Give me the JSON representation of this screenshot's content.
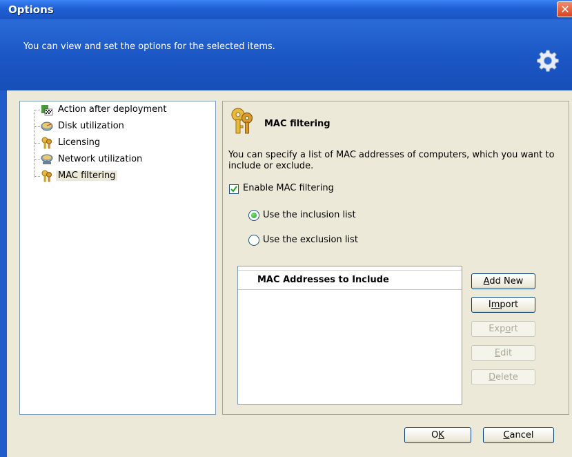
{
  "window": {
    "title": "Options",
    "close_label": "✕"
  },
  "header": {
    "text": "You can view and set the options for the selected items.",
    "icon": "gear-icon"
  },
  "tree": {
    "items": [
      {
        "label": "Action after deployment",
        "icon": "deployment-flag-icon",
        "selected": false
      },
      {
        "label": "Disk utilization",
        "icon": "disk-icon",
        "selected": false
      },
      {
        "label": "Licensing",
        "icon": "keys-icon",
        "selected": false
      },
      {
        "label": "Network utilization",
        "icon": "network-icon",
        "selected": false
      },
      {
        "label": "MAC filtering",
        "icon": "keys-icon",
        "selected": true
      }
    ]
  },
  "panel": {
    "title": "MAC filtering",
    "icon": "keys-icon",
    "description": "You can specify a list of MAC addresses of computers, which you want to include or exclude.",
    "enable_checkbox": {
      "label": "Enable MAC filtering",
      "checked": true
    },
    "radio_inclusion": {
      "label": "Use the inclusion list",
      "selected": true
    },
    "radio_exclusion": {
      "label": "Use the exclusion list",
      "selected": false
    },
    "list": {
      "header": "MAC Addresses to Include",
      "rows": []
    },
    "buttons": {
      "add_new": {
        "prefix": "",
        "key": "A",
        "rest": "dd New",
        "enabled": true
      },
      "import": {
        "prefix": "I",
        "key": "m",
        "rest": "port",
        "enabled": true
      },
      "export": {
        "prefix": "Exp",
        "key": "o",
        "rest": "rt",
        "enabled": false
      },
      "edit": {
        "prefix": "",
        "key": "E",
        "rest": "dit",
        "enabled": false
      },
      "delete": {
        "prefix": "",
        "key": "D",
        "rest": "elete",
        "enabled": false
      }
    }
  },
  "footer": {
    "ok": {
      "prefix": "O",
      "key": "K",
      "rest": ""
    },
    "cancel": {
      "prefix": "",
      "key": "C",
      "rest": "ancel"
    }
  },
  "colors": {
    "title_blue": "#1f5fd4",
    "header_blue": "#1a56c4",
    "dialog_bg": "#ece9d8",
    "close_red": "#d8421f",
    "radio_green": "#21a121"
  }
}
